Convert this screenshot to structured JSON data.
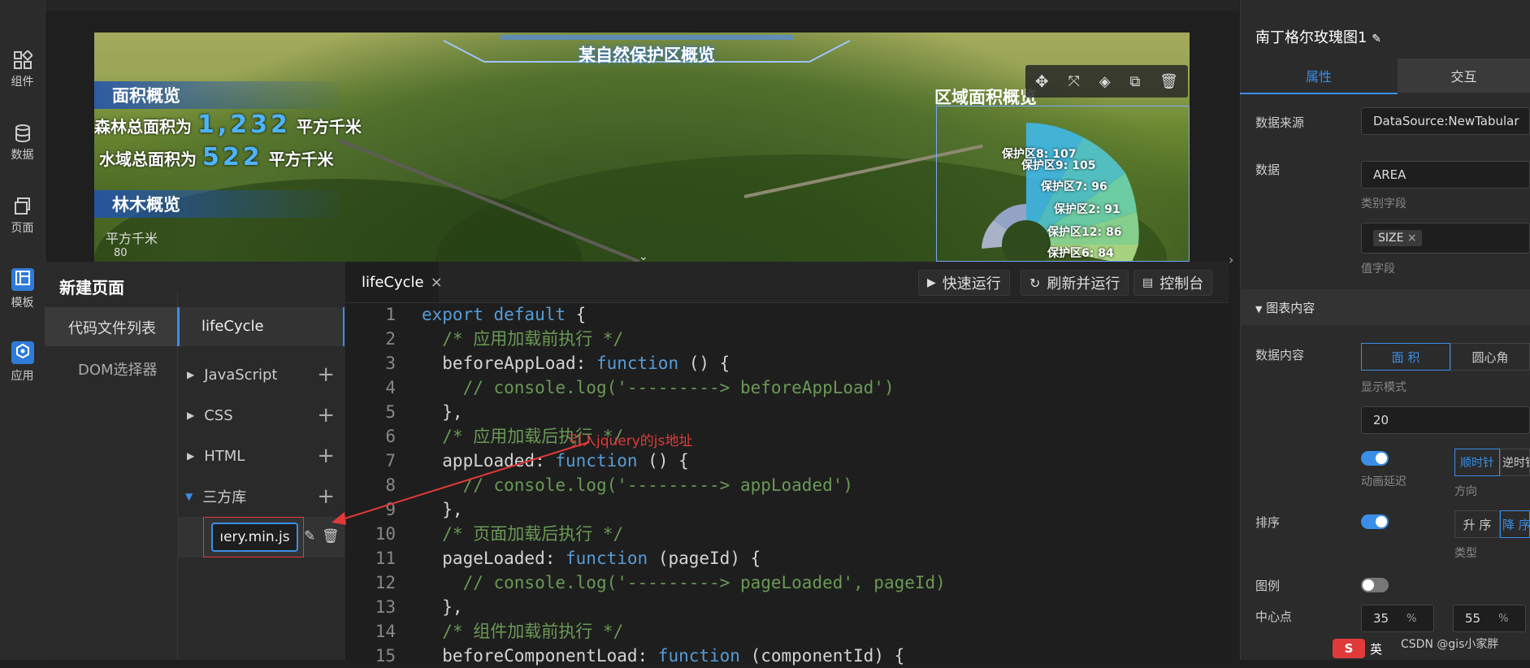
{
  "rail": {
    "items": [
      {
        "label": "组件",
        "icon": "components-icon"
      },
      {
        "label": "数据",
        "icon": "database-icon"
      },
      {
        "label": "页面",
        "icon": "pages-icon"
      },
      {
        "label": "模板",
        "icon": "template-icon"
      },
      {
        "label": "应用",
        "icon": "app-icon"
      }
    ]
  },
  "canvas": {
    "title": "某自然保护区概览",
    "area_overview": "面积概览",
    "forest_prefix": "森林总面积为",
    "forest_value": "1,232",
    "forest_unit": "平方千米",
    "water_prefix": "水域总面积为",
    "water_value": "522",
    "water_unit": "平方千米",
    "trees_overview": "林木概览",
    "axis_unit": "平方千米",
    "axis_tick": "80",
    "region_title": "区域面积概览",
    "rose_labels": [
      "保护区8: 107",
      "保护区9: 105",
      "保护区7: 96",
      "保护区2: 91",
      "保护区12: 86",
      "保护区6: 84"
    ],
    "rose_colors": [
      "#3fb8e8",
      "#52c7d0",
      "#6fd6b0",
      "#8edc98",
      "#b2e08a",
      "#cfe488"
    ]
  },
  "left_panel": {
    "title": "新建页面",
    "tab_files": "代码文件列表",
    "tab_dom": "DOM选择器",
    "active_file": "lifeCycle",
    "tree": [
      {
        "label": "JavaScript",
        "expanded": false
      },
      {
        "label": "CSS",
        "expanded": false
      },
      {
        "label": "HTML",
        "expanded": false
      },
      {
        "label": "三方库",
        "expanded": true
      }
    ],
    "library_file": "ıery.min.js"
  },
  "editor": {
    "tab": "lifeCycle",
    "btn_run": "快速运行",
    "btn_refresh": "刷新并运行",
    "btn_console": "控制台",
    "annotation": "引入jquery的js地址",
    "lines": [
      {
        "n": "1",
        "parts": [
          [
            "kw",
            "export default"
          ],
          [
            "p",
            " {"
          ]
        ]
      },
      {
        "n": "2",
        "parts": [
          [
            "p",
            "  "
          ],
          [
            "cm",
            "/* 应用加载前执行 */"
          ]
        ]
      },
      {
        "n": "3",
        "parts": [
          [
            "p",
            "  beforeAppLoad: "
          ],
          [
            "kw",
            "function"
          ],
          [
            "p",
            " () {"
          ]
        ]
      },
      {
        "n": "4",
        "parts": [
          [
            "p",
            "    "
          ],
          [
            "cm",
            "// console.log('---------> beforeAppLoad')"
          ]
        ]
      },
      {
        "n": "5",
        "parts": [
          [
            "p",
            "  },"
          ]
        ]
      },
      {
        "n": "6",
        "parts": [
          [
            "p",
            "  "
          ],
          [
            "cm",
            "/* 应用加载后执行 */"
          ]
        ]
      },
      {
        "n": "7",
        "parts": [
          [
            "p",
            "  appLoaded: "
          ],
          [
            "kw",
            "function"
          ],
          [
            "p",
            " () {"
          ]
        ]
      },
      {
        "n": "8",
        "parts": [
          [
            "p",
            "    "
          ],
          [
            "cm",
            "// console.log('---------> appLoaded')"
          ]
        ]
      },
      {
        "n": "9",
        "parts": [
          [
            "p",
            "  },"
          ]
        ]
      },
      {
        "n": "10",
        "parts": [
          [
            "p",
            "  "
          ],
          [
            "cm",
            "/* 页面加载后执行 */"
          ]
        ]
      },
      {
        "n": "11",
        "parts": [
          [
            "p",
            "  pageLoaded: "
          ],
          [
            "kw",
            "function"
          ],
          [
            "p",
            " (pageId) {"
          ]
        ]
      },
      {
        "n": "12",
        "parts": [
          [
            "p",
            "    "
          ],
          [
            "cm",
            "// console.log('---------> pageLoaded', pageId)"
          ]
        ]
      },
      {
        "n": "13",
        "parts": [
          [
            "p",
            "  },"
          ]
        ]
      },
      {
        "n": "14",
        "parts": [
          [
            "p",
            "  "
          ],
          [
            "cm",
            "/* 组件加载前执行 */"
          ]
        ]
      },
      {
        "n": "15",
        "parts": [
          [
            "p",
            "  beforeComponentLoad: "
          ],
          [
            "kw",
            "function"
          ],
          [
            "p",
            " (componentId) {"
          ]
        ]
      }
    ]
  },
  "props": {
    "title": "南丁格尔玫瑰图1",
    "tab_attrs": "属性",
    "tab_interact": "交互",
    "data_source_label": "数据来源",
    "data_source_value": "DataSource:NewTabular",
    "data_label": "数据",
    "category_value": "AREA",
    "category_hint": "类别字段",
    "value_tag": "SIZE",
    "value_hint": "值字段",
    "section_chart": "图表内容",
    "data_content_label": "数据内容",
    "seg_area": "面 积",
    "seg_radius": "圆心角",
    "display_mode_hint": "显示模式",
    "display_count": "20",
    "anim_hint": "动画延迟",
    "dir_cw": "顺时针",
    "dir_ccw": "逆时针",
    "dir_hint": "方向",
    "sort_label": "排序",
    "sort_asc": "升 序",
    "sort_desc": "降 序",
    "sort_hint": "类型",
    "legend_label": "图例",
    "center_label": "中心点",
    "center_x": "35",
    "center_y": "55",
    "pct": "%",
    "watermark": "CSDN @gis小家胖",
    "ime": "英"
  }
}
